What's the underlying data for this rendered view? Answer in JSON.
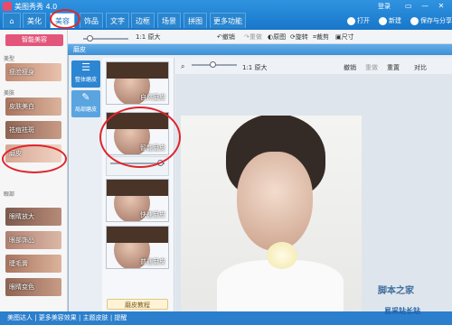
{
  "app": {
    "title": "美图秀秀 4.0"
  },
  "nav": {
    "tabs": [
      "美化",
      "美容",
      "饰品",
      "文字",
      "边框",
      "场景",
      "拼图",
      "更多功能"
    ],
    "active": "美容",
    "right_buttons": [
      "打开",
      "新建",
      "保存与分享"
    ],
    "login": "登录"
  },
  "toolbar": {
    "zoom_label": "1:1 原大",
    "undo": "撤销",
    "redo": "重做",
    "original": "原图",
    "rotate": "旋转",
    "crop": "裁剪",
    "size": "尺寸"
  },
  "left": {
    "smart_button": "智能美容",
    "categories": [
      "美型",
      "美肤",
      "眼部"
    ],
    "items": [
      "瘦脸瘦身",
      "皮肤美白",
      "祛痘祛斑",
      "磨皮",
      "眼睛放大",
      "眼部饰品",
      "睫毛膏",
      "眼睛变色"
    ]
  },
  "dialog": {
    "title": "磨皮",
    "modes": [
      "整体磨皮",
      "局部磨皮"
    ],
    "presets": [
      "自然磨皮",
      "智能磨皮",
      "快速磨皮",
      "普通磨皮"
    ],
    "tutorial": "磨皮教程",
    "canvas_zoom": "1:1 原大",
    "canvas_undo": "撤销",
    "canvas_redo": "重做",
    "canvas_reset": "重置",
    "canvas_compare": "对比"
  },
  "status": {
    "text": "美图达人 | 更多美容效果 | 主题皮肤 | 提醒"
  },
  "watermark": {
    "line1": "脚本之家",
    "line2": "易采站长站"
  },
  "colors": {
    "topbar": "#1976c9",
    "accent_pink": "#e2567a",
    "annotation": "#e0252c"
  }
}
